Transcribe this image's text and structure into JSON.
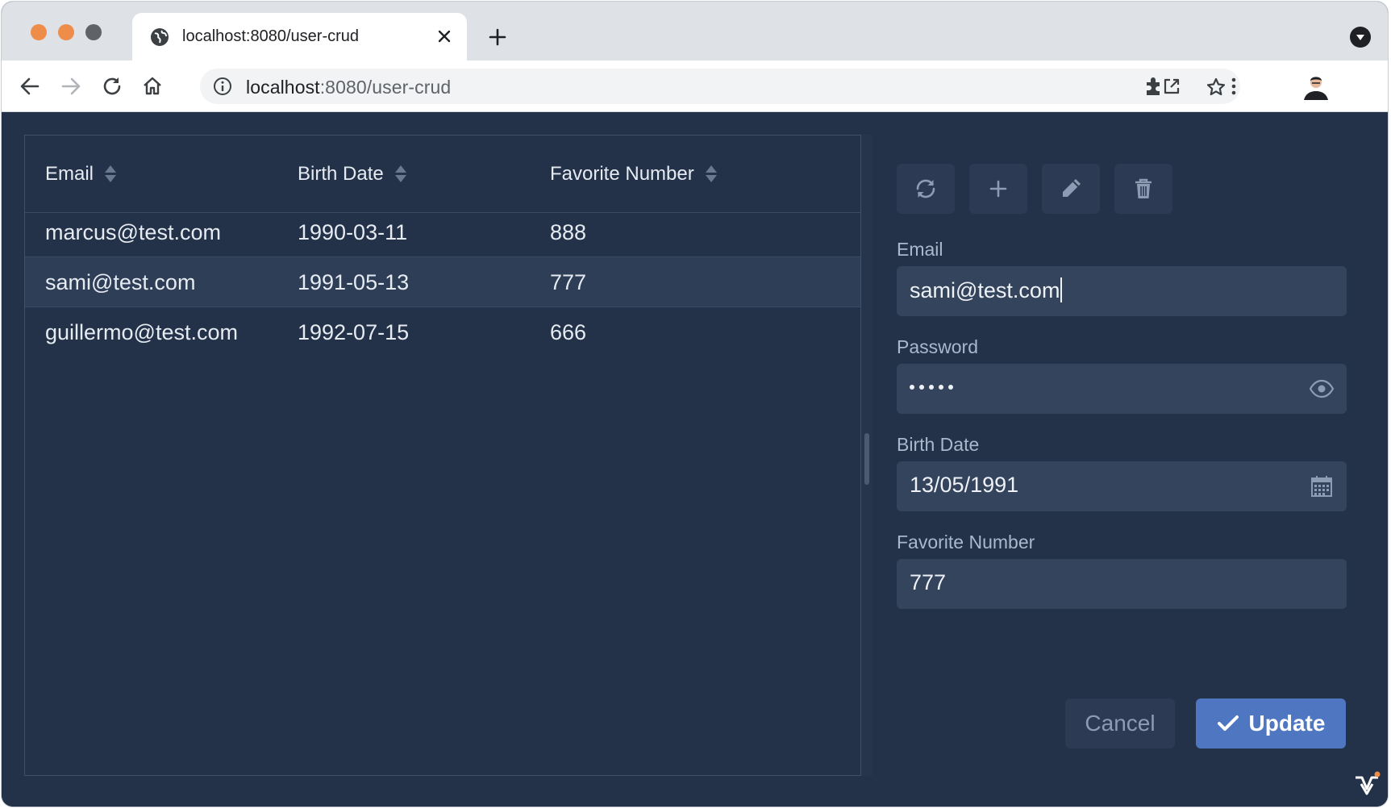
{
  "browser": {
    "tab_title": "localhost:8080/user-crud",
    "url_host": "localhost",
    "url_rest": ":8080/user-crud"
  },
  "grid": {
    "columns": [
      "Email",
      "Birth Date",
      "Favorite Number"
    ],
    "rows": [
      {
        "email": "marcus@test.com",
        "birth_date": "1990-03-11",
        "favorite_number": "888"
      },
      {
        "email": "sami@test.com",
        "birth_date": "1991-05-13",
        "favorite_number": "777"
      },
      {
        "email": "guillermo@test.com",
        "birth_date": "1992-07-15",
        "favorite_number": "666"
      }
    ],
    "selected_row": 1
  },
  "editor": {
    "toolbar_icons": [
      "refresh-icon",
      "plus-icon",
      "pencil-icon",
      "trash-icon"
    ],
    "email": {
      "label": "Email",
      "value": "sami@test.com"
    },
    "password": {
      "label": "Password",
      "masked_length": 5
    },
    "birth_date": {
      "label": "Birth Date",
      "value": "13/05/1991"
    },
    "favorite_number": {
      "label": "Favorite Number",
      "value": "777"
    },
    "cancel_label": "Cancel",
    "update_label": "Update"
  },
  "colors": {
    "app_background": "#233249",
    "accent": "#4f76c0",
    "field_background": "#34445c"
  }
}
